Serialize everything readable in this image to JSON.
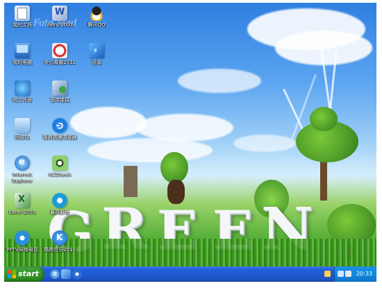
{
  "desktop": {
    "watermark": "Foto Mad",
    "icons": [
      {
        "label": "我的文档",
        "icon": "my-documents-icon"
      },
      {
        "label": "Word 2003",
        "icon": "word-icon"
      },
      {
        "label": "腾讯QQ",
        "icon": "qq-icon"
      },
      {
        "label": "我的电脑",
        "icon": "my-computer-icon"
      },
      {
        "label": "金山毒霸2011",
        "icon": "kingsoft-antivirus-icon"
      },
      {
        "label": "迅雷",
        "icon": "thunder-icon"
      },
      {
        "label": "网上邻居",
        "icon": "network-places-icon"
      },
      {
        "label": "宽带连接",
        "icon": "broadband-connection-icon"
      },
      {
        "label": "回收站",
        "icon": "recycle-bin-icon"
      },
      {
        "label": "搜狗高速浏览器",
        "icon": "sogou-browser-icon"
      },
      {
        "label": "Internet Explorer",
        "icon": "internet-explorer-icon"
      },
      {
        "label": "ACDSee5",
        "icon": "acdsee-icon"
      },
      {
        "label": "Excel 2003",
        "icon": "excel-icon"
      },
      {
        "label": "暴风影音",
        "icon": "baofeng-player-icon"
      },
      {
        "label": "PPTV网络电视",
        "icon": "pptv-icon"
      },
      {
        "label": "酷狗音乐2011",
        "icon": "kugou-music-icon"
      }
    ],
    "wallpaper_text": "GREEN"
  },
  "taskbar": {
    "start_label": "start",
    "clock": "20:33",
    "quick_launch": [
      "internet-explorer-icon",
      "show-desktop-icon",
      "media-player-icon"
    ],
    "tray_icons": [
      "network-tray-icon",
      "volume-tray-icon",
      "security-tray-icon"
    ]
  },
  "colors": {
    "taskbar": "#245edb",
    "start_button": "#389c2d",
    "tray": "#128ae0"
  }
}
